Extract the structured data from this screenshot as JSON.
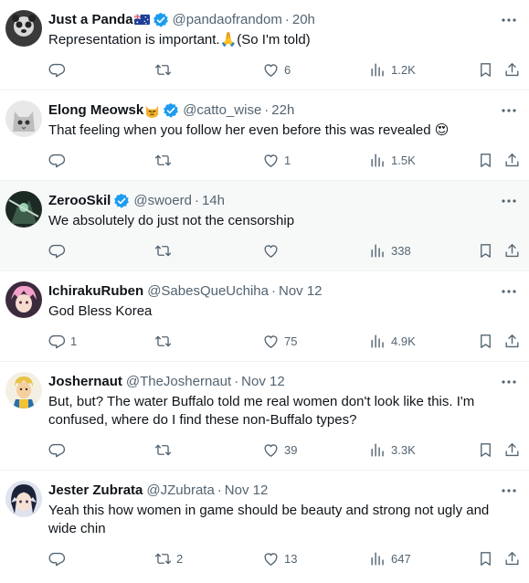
{
  "tweets": [
    {
      "name": "Just a Panda",
      "name_emoji": "australia-flag",
      "handle": "@pandaofrandom",
      "time": "20h",
      "text": "Representation is important.🙏(So I'm told)",
      "replies": "",
      "retweets": "",
      "likes": "6",
      "views": "1.2K",
      "verified": true
    },
    {
      "name": "Elong Meowsk",
      "name_emoji": "pouting-cat",
      "handle": "@catto_wise",
      "time": "22h",
      "text": "That  feeling when you follow her even before this was revealed 😍",
      "replies": "",
      "retweets": "",
      "likes": "1",
      "views": "1.5K",
      "verified": true
    },
    {
      "name": "ZerooSkil",
      "handle": "@swoerd",
      "time": "14h",
      "text": "We absolutely do just not the censorship",
      "replies": "",
      "retweets": "",
      "likes": "",
      "views": "338",
      "verified": true
    },
    {
      "name": "IchirakuRuben",
      "handle": "@SabesQueUchiha",
      "time": "Nov 12",
      "text": "God Bless Korea",
      "replies": "1",
      "retweets": "",
      "likes": "75",
      "views": "4.9K",
      "verified": false
    },
    {
      "name": "Joshernaut",
      "handle": "@TheJoshernaut",
      "time": "Nov 12",
      "text": "But, but? The water Buffalo told me real women don't look like this. I'm confused, where do I find these non-Buffalo types?",
      "replies": "",
      "retweets": "",
      "likes": "39",
      "views": "3.3K",
      "verified": false
    },
    {
      "name": "Jester Zubrata",
      "handle": "@JZubrata",
      "time": "Nov 12",
      "text": "Yeah this how women in game  should be beauty and strong not ugly and wide chin",
      "replies": "",
      "retweets": "2",
      "likes": "13",
      "views": "647",
      "verified": false
    }
  ],
  "colors": {
    "verified": "#1d9bf0",
    "secondary_text": "#536471",
    "primary_text": "#0f1419",
    "highlight_bg": "#f7f9f9"
  }
}
